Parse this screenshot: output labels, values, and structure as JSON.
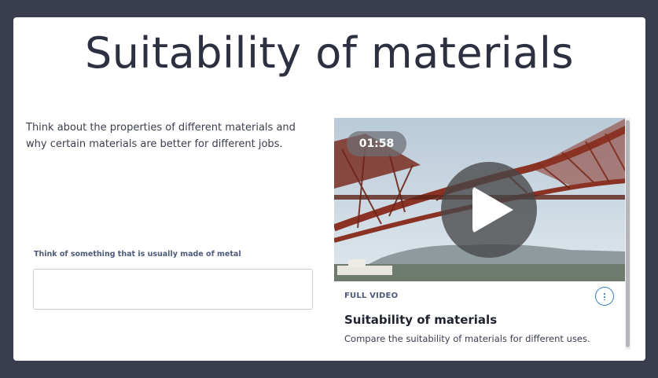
{
  "page": {
    "title": "Suitability of materials",
    "intro": "Think about the properties of different materials and why certain materials are better for different jobs."
  },
  "question": {
    "label": "Think of something that is usually made of metal",
    "value": ""
  },
  "video": {
    "duration": "01:58",
    "tag": "FULL VIDEO",
    "title": "Suitability of materials",
    "description": "Compare the suitability of materials for different uses.",
    "play_icon": "play-icon",
    "more_icon": "kebab-icon"
  },
  "colors": {
    "background": "#393d4d",
    "card": "#ffffff",
    "accent": "#3b84c4",
    "bridge": "#8a3325"
  }
}
